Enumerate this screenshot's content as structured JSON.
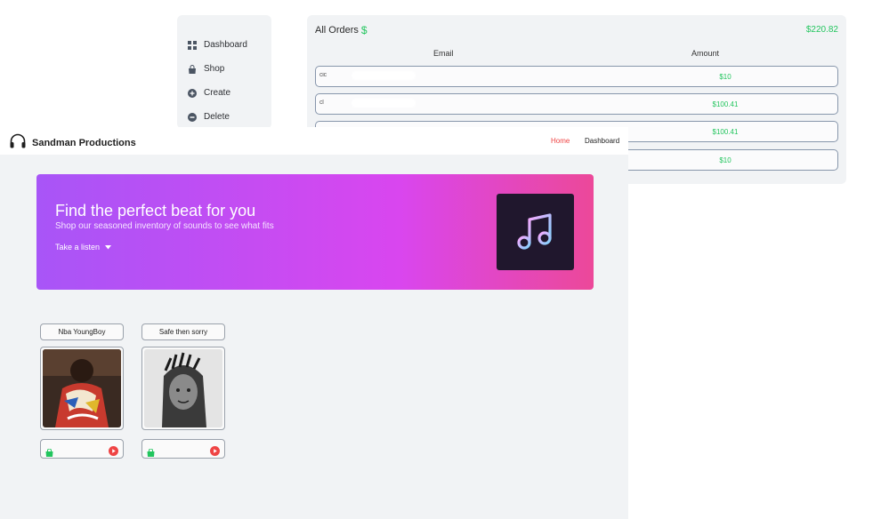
{
  "admin": {
    "sidebar": {
      "items": [
        {
          "label": "Dashboard",
          "icon": "grid-icon"
        },
        {
          "label": "Shop",
          "icon": "bag-icon"
        },
        {
          "label": "Create",
          "icon": "plus-circle-icon"
        },
        {
          "label": "Delete",
          "icon": "minus-circle-icon"
        }
      ]
    },
    "orders": {
      "title": "All Orders",
      "title_symbol": "$",
      "total": "$220.82",
      "columns": [
        "Email",
        "Amount"
      ],
      "rows": [
        {
          "email": "cic",
          "amount": "$10"
        },
        {
          "email": "cl",
          "amount": "$100.41"
        },
        {
          "email": "",
          "amount": "$100.41"
        },
        {
          "email": "",
          "amount": "$10"
        }
      ]
    }
  },
  "site": {
    "brand": "Sandman Productions",
    "nav": {
      "home": "Home",
      "dashboard": "Dashboard"
    },
    "hero": {
      "title": "Find the perfect beat for you",
      "subtitle": "Shop our seasoned inventory of sounds to see what fits",
      "cta": "Take a listen"
    },
    "beats": [
      {
        "title": "Nba YoungBoy"
      },
      {
        "title": "Safe then sorry"
      }
    ]
  },
  "colors": {
    "accent_green": "#23c55e",
    "nav_active": "#ef4444",
    "hero_start": "#a855f7",
    "hero_end": "#ec4899",
    "play_red": "#ef4444"
  }
}
